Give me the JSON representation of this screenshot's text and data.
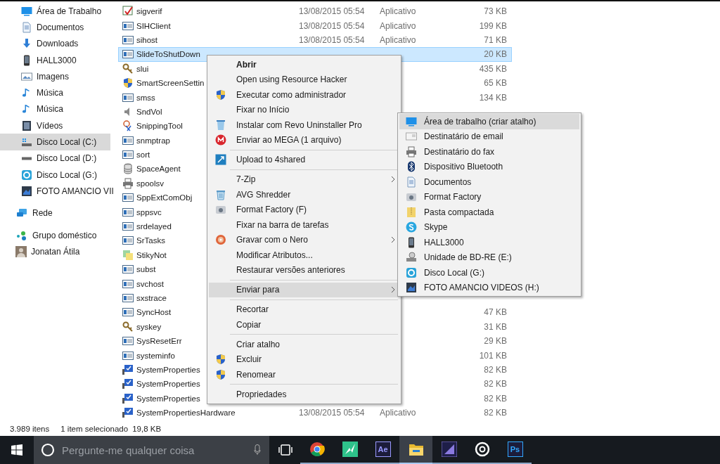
{
  "sidebar": {
    "sections": [
      [
        {
          "label": "Área de Trabalho",
          "kind": "desktop",
          "selected": false
        },
        {
          "label": "Documentos",
          "kind": "document",
          "selected": false
        },
        {
          "label": "Downloads",
          "kind": "download",
          "selected": false
        },
        {
          "label": "HALL3000",
          "kind": "phone",
          "selected": false
        },
        {
          "label": "Imagens",
          "kind": "picture",
          "selected": false
        },
        {
          "label": "Música",
          "kind": "music",
          "selected": false
        },
        {
          "label": "Música",
          "kind": "music",
          "selected": false
        },
        {
          "label": "Vídeos",
          "kind": "film",
          "selected": false
        },
        {
          "label": "Disco Local (C:)",
          "kind": "system-drive",
          "selected": true
        },
        {
          "label": "Disco Local (D:)",
          "kind": "drive",
          "selected": false
        },
        {
          "label": "Disco Local (G:)",
          "kind": "round-drive",
          "selected": false
        },
        {
          "label": "FOTO AMANCIO VII",
          "kind": "photo-drive",
          "selected": false
        }
      ],
      [
        {
          "label": "Rede",
          "kind": "network",
          "selected": false
        }
      ],
      [
        {
          "label": "Grupo doméstico",
          "kind": "homegroup",
          "selected": false
        },
        {
          "label": "Jonatan Átila",
          "kind": "user",
          "selected": false
        }
      ]
    ]
  },
  "files": {
    "rows": [
      {
        "name": "sigverif",
        "kind": "check",
        "date": "13/08/2015 05:54",
        "type": "Aplicativo",
        "size": "73 KB",
        "selected": false
      },
      {
        "name": "SIHClient",
        "kind": "app",
        "date": "13/08/2015 05:54",
        "type": "Aplicativo",
        "size": "199 KB",
        "selected": false
      },
      {
        "name": "sihost",
        "kind": "app",
        "date": "13/08/2015 05:54",
        "type": "Aplicativo",
        "size": "71 KB",
        "selected": false
      },
      {
        "name": "SlideToShutDown",
        "kind": "app",
        "size": "20 KB",
        "selected": true
      },
      {
        "name": "slui",
        "kind": "keys",
        "size": "435 KB",
        "selected": false
      },
      {
        "name": "SmartScreenSettin",
        "kind": "shield",
        "size": "65 KB",
        "selected": false
      },
      {
        "name": "smss",
        "kind": "app",
        "size": "134 KB",
        "selected": false
      },
      {
        "name": "SndVol",
        "kind": "speaker",
        "selected": false
      },
      {
        "name": "SnippingTool",
        "kind": "scissors",
        "selected": false
      },
      {
        "name": "snmptrap",
        "kind": "app",
        "selected": false
      },
      {
        "name": "sort",
        "kind": "app",
        "selected": false
      },
      {
        "name": "SpaceAgent",
        "kind": "database",
        "selected": false
      },
      {
        "name": "spoolsv",
        "kind": "printer",
        "selected": false
      },
      {
        "name": "SppExtComObj",
        "kind": "app",
        "selected": false
      },
      {
        "name": "sppsvc",
        "kind": "app",
        "selected": false
      },
      {
        "name": "srdelayed",
        "kind": "app",
        "selected": false
      },
      {
        "name": "SrTasks",
        "kind": "app",
        "selected": false
      },
      {
        "name": "StikyNot",
        "kind": "notes",
        "selected": false
      },
      {
        "name": "subst",
        "kind": "app",
        "selected": false
      },
      {
        "name": "svchost",
        "kind": "app",
        "selected": false
      },
      {
        "name": "sxstrace",
        "kind": "app",
        "selected": false
      },
      {
        "name": "SyncHost",
        "kind": "app",
        "size": "47 KB",
        "selected": false
      },
      {
        "name": "syskey",
        "kind": "keys",
        "size": "31 KB",
        "selected": false
      },
      {
        "name": "SysResetErr",
        "kind": "app",
        "size": "29 KB",
        "selected": false
      },
      {
        "name": "systeminfo",
        "kind": "app",
        "size": "101 KB",
        "selected": false
      },
      {
        "name": "SystemProperties",
        "kind": "monitor",
        "size": "82 KB",
        "selected": false
      },
      {
        "name": "SystemProperties",
        "kind": "monitor",
        "size": "82 KB",
        "selected": false
      },
      {
        "name": "SystemProperties",
        "kind": "monitor",
        "size": "82 KB",
        "selected": false
      },
      {
        "name": "SystemPropertiesHardware",
        "kind": "monitor",
        "date": "13/08/2015 05:54",
        "type": "Aplicativo",
        "size": "82 KB",
        "selected": false
      }
    ]
  },
  "status_bar": {
    "count": "3.989 itens",
    "selection": "1 item selecionado",
    "size": "19,8 KB"
  },
  "context_menu": {
    "groups": [
      [
        {
          "label": "Abrir",
          "kind": "plain",
          "default": true,
          "submenu": false,
          "selected": false
        },
        {
          "label": "Open using Resource Hacker",
          "kind": "plain",
          "default": false,
          "submenu": false,
          "selected": false
        },
        {
          "label": "Executar como administrador",
          "kind": "shield",
          "default": false,
          "submenu": false,
          "selected": false
        },
        {
          "label": "Fixar no Início",
          "kind": "plain",
          "default": false,
          "submenu": false,
          "selected": false
        },
        {
          "label": "Instalar com Revo Uninstaller Pro",
          "kind": "bin",
          "default": false,
          "submenu": false,
          "selected": false
        },
        {
          "label": "Enviar ao MEGA (1 arquivo)",
          "kind": "mega",
          "default": false,
          "submenu": false,
          "selected": false
        }
      ],
      [
        {
          "label": "Upload to 4shared",
          "kind": "upload",
          "default": false,
          "submenu": false,
          "selected": false
        }
      ],
      [
        {
          "label": "7-Zip",
          "kind": "plain",
          "default": false,
          "submenu": true,
          "selected": false
        },
        {
          "label": "AVG Shredder",
          "kind": "shredder",
          "default": false,
          "submenu": false,
          "selected": false
        },
        {
          "label": "Format Factory (F)",
          "kind": "factory",
          "default": false,
          "submenu": false,
          "selected": false
        },
        {
          "label": "Fixar na barra de tarefas",
          "kind": "plain",
          "default": false,
          "submenu": false,
          "selected": false
        },
        {
          "label": "Gravar com o Nero",
          "kind": "disc",
          "default": false,
          "submenu": true,
          "selected": false
        },
        {
          "label": "Modificar Atributos...",
          "kind": "plain",
          "default": false,
          "submenu": false,
          "selected": false
        },
        {
          "label": "Restaurar versões anteriores",
          "kind": "plain",
          "default": false,
          "submenu": false,
          "selected": false
        }
      ],
      [
        {
          "label": "Enviar para",
          "kind": "plain",
          "default": false,
          "submenu": true,
          "selected": true
        }
      ],
      [
        {
          "label": "Recortar",
          "kind": "plain",
          "default": false,
          "submenu": false,
          "selected": false
        },
        {
          "label": "Copiar",
          "kind": "plain",
          "default": false,
          "submenu": false,
          "selected": false
        }
      ],
      [
        {
          "label": "Criar atalho",
          "kind": "plain",
          "default": false,
          "submenu": false,
          "selected": false
        },
        {
          "label": "Excluir",
          "kind": "shield",
          "default": false,
          "submenu": false,
          "selected": false
        },
        {
          "label": "Renomear",
          "kind": "shield",
          "default": false,
          "submenu": false,
          "selected": false
        }
      ],
      [
        {
          "label": "Propriedades",
          "kind": "plain",
          "default": false,
          "submenu": false,
          "selected": false
        }
      ]
    ]
  },
  "send_to_menu": {
    "items": [
      {
        "label": "Área de trabalho (criar atalho)",
        "kind": "desktop",
        "selected": true
      },
      {
        "label": "Destinatário de email",
        "kind": "envelope",
        "selected": false
      },
      {
        "label": "Destinatário do fax",
        "kind": "printer",
        "selected": false
      },
      {
        "label": "Dispositivo Bluetooth",
        "kind": "bluetooth",
        "selected": false
      },
      {
        "label": "Documentos",
        "kind": "document",
        "selected": false
      },
      {
        "label": "Format Factory",
        "kind": "factory",
        "selected": false
      },
      {
        "label": "Pasta compactada",
        "kind": "zip",
        "selected": false
      },
      {
        "label": "Skype",
        "kind": "skype",
        "selected": false
      },
      {
        "label": "HALL3000",
        "kind": "phone",
        "selected": false
      },
      {
        "label": "Unidade de BD-RE (E:)",
        "kind": "optical",
        "selected": false
      },
      {
        "label": "Disco Local (G:)",
        "kind": "round-drive",
        "selected": false
      },
      {
        "label": "FOTO AMANCIO VIDEOS (H:)",
        "kind": "photo-drive",
        "selected": false
      }
    ]
  },
  "taskbar": {
    "search": {
      "placeholder": "Pergunte-me qualquer coisa"
    },
    "apps": [
      {
        "kind": "chrome",
        "active": false
      },
      {
        "kind": "bolt",
        "active": false
      },
      {
        "kind": "tile",
        "label": "Ae",
        "color": "#9999ff",
        "active": false
      },
      {
        "kind": "folder",
        "active": true
      },
      {
        "kind": "film",
        "active": false
      },
      {
        "kind": "disc",
        "active": false
      },
      {
        "kind": "tile",
        "label": "Ps",
        "color": "#31a8ff",
        "active": false
      }
    ]
  }
}
